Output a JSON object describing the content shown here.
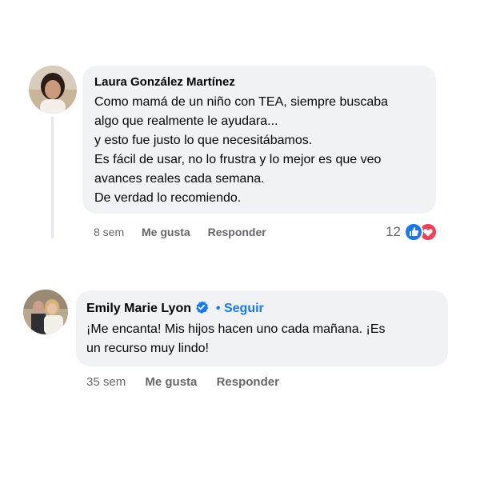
{
  "comments": [
    {
      "author": "Laura González Martínez",
      "lines": [
        "Como mamá de un niño con TEA, siempre buscaba",
        "algo que realmente le ayudara...",
        "y esto fue justo lo que necesitábamos.",
        "Es fácil de usar, no lo frustra y lo mejor es que veo",
        "avances reales cada semana.",
        "De verdad lo recomiendo."
      ],
      "time": "8 sem",
      "like_label": "Me gusta",
      "reply_label": "Responder",
      "reaction_count": "12",
      "reaction_icons": [
        "like-icon",
        "heart-icon"
      ]
    },
    {
      "author": "Emily Marie Lyon",
      "verified_icon": "verified-badge-icon",
      "separator": "•",
      "follow_label": "Seguir",
      "lines": [
        "¡Me encanta! Mis hijos hacen uno cada mañana. ¡Es",
        "un recurso muy lindo!"
      ],
      "time": "35 sem",
      "like_label": "Me gusta",
      "reply_label": "Responder"
    }
  ],
  "colors": {
    "bubble": "#f0f2f5",
    "link_blue": "#1877f2",
    "like_blue": "#1877f2",
    "heart_red": "#f33e58",
    "meta_gray": "#65676b"
  }
}
